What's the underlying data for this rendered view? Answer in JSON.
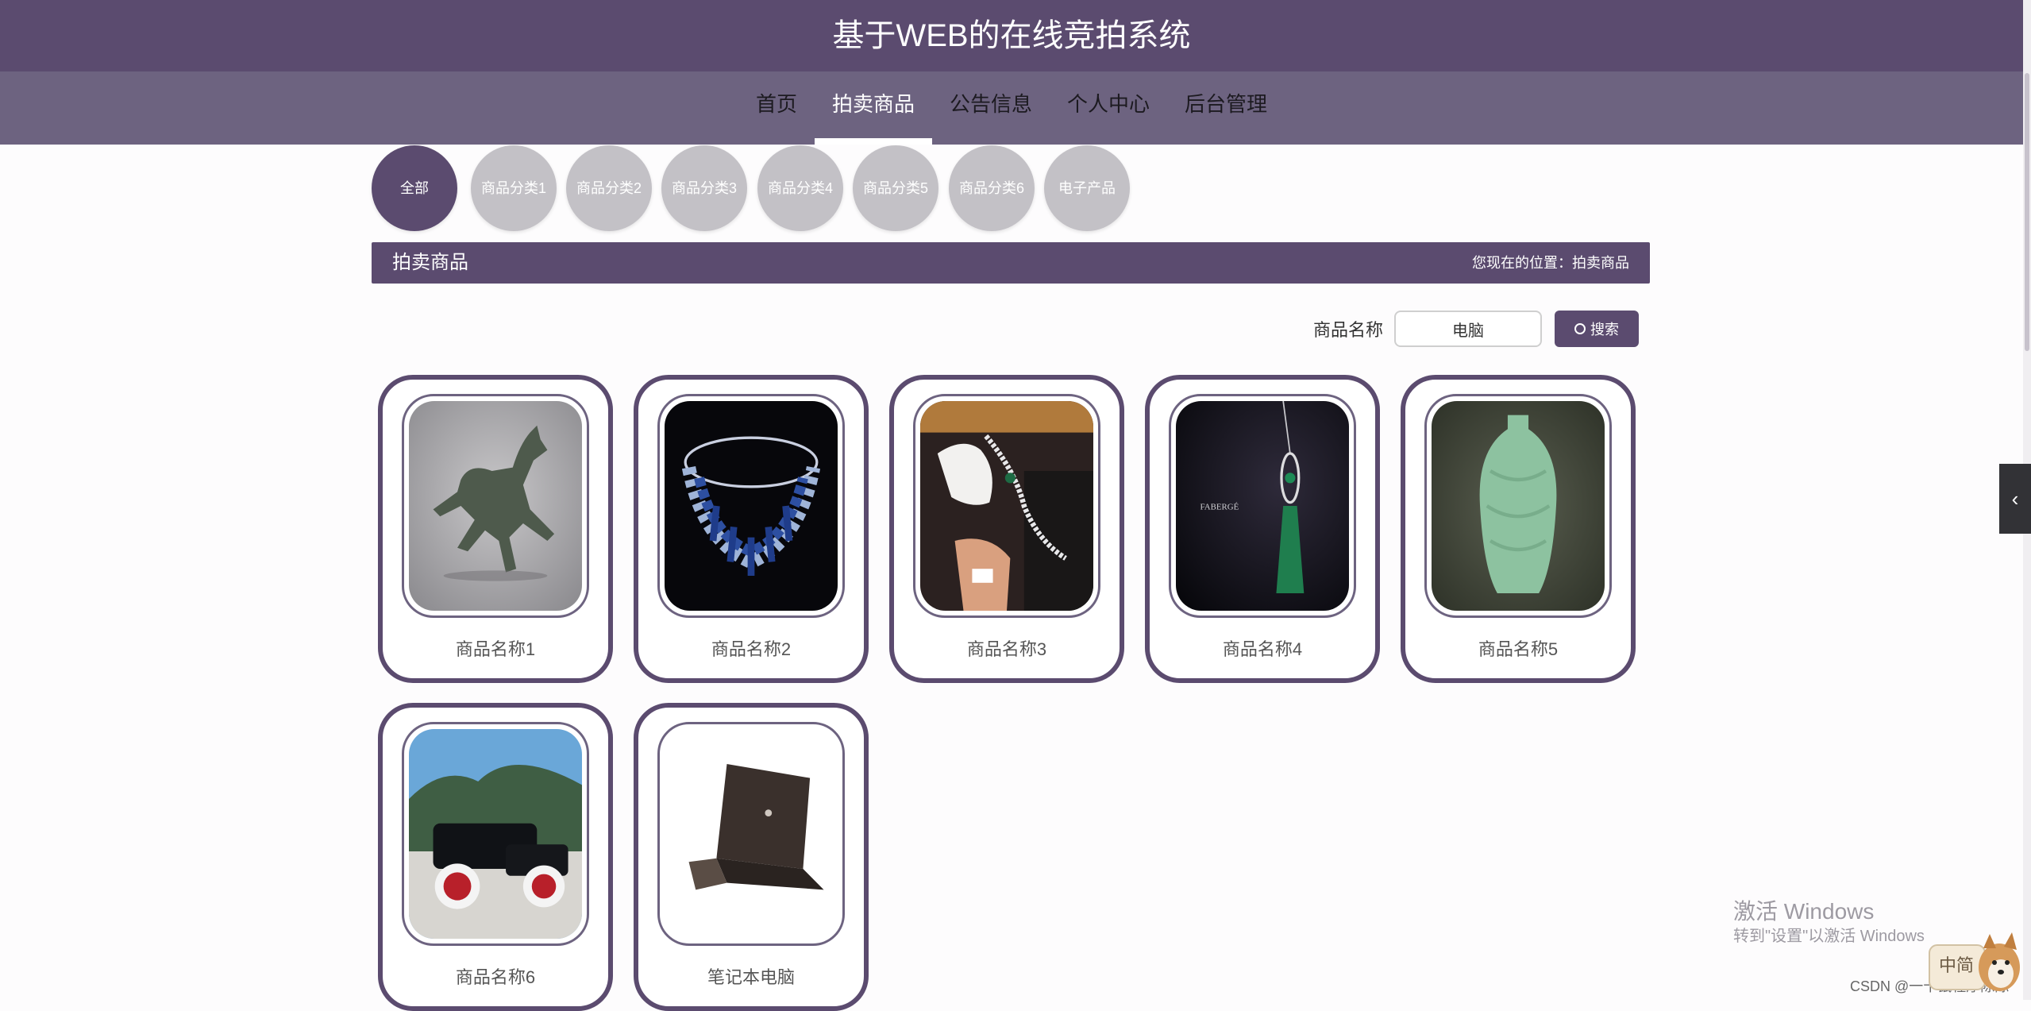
{
  "header": {
    "title": "基于WEB的在线竞拍系统"
  },
  "nav": {
    "items": [
      {
        "label": "首页"
      },
      {
        "label": "拍卖商品"
      },
      {
        "label": "公告信息"
      },
      {
        "label": "个人中心"
      },
      {
        "label": "后台管理"
      }
    ],
    "active_index": 1
  },
  "categories": [
    {
      "label": "全部"
    },
    {
      "label": "商品分类1"
    },
    {
      "label": "商品分类2"
    },
    {
      "label": "商品分类3"
    },
    {
      "label": "商品分类4"
    },
    {
      "label": "商品分类5"
    },
    {
      "label": "商品分类6"
    },
    {
      "label": "电子产品"
    }
  ],
  "section": {
    "title": "拍卖商品",
    "breadcrumb": "您现在的位置：拍卖商品"
  },
  "search": {
    "label": "商品名称",
    "value": "电脑",
    "button_label": "搜索"
  },
  "products": [
    {
      "name": "商品名称1",
      "image": "bronze-horse-statue"
    },
    {
      "name": "商品名称2",
      "image": "sapphire-necklace"
    },
    {
      "name": "商品名称3",
      "image": "diamond-necklace-gloved-hand"
    },
    {
      "name": "商品名称4",
      "image": "emerald-tassel-pendant"
    },
    {
      "name": "商品名称5",
      "image": "celadon-vase"
    },
    {
      "name": "商品名称6",
      "image": "vintage-car"
    },
    {
      "name": "笔记本电脑",
      "image": "laptop"
    }
  ],
  "watermark": {
    "line1": "激活 Windows",
    "line2": "转到\"设置\"以激活 Windows"
  },
  "footer_credit": "CSDN @一十鼠程序陈陈",
  "ime_label": "中简",
  "colors": {
    "brand": "#5b4b6f",
    "nav_bg": "#6d6380",
    "category_inactive": "#c3c1c6"
  }
}
